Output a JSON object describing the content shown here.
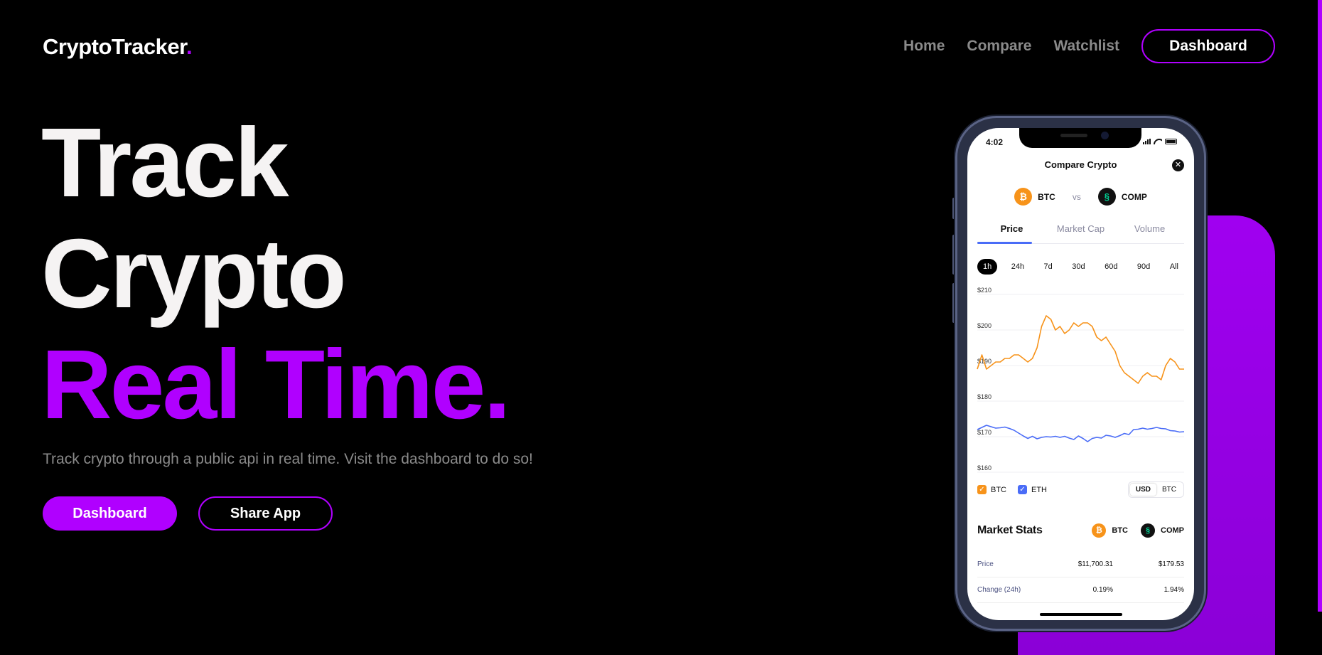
{
  "header": {
    "logo": "CryptoTracker",
    "logo_dot": ".",
    "nav": [
      "Home",
      "Compare",
      "Watchlist"
    ],
    "dashboard_button": "Dashboard"
  },
  "hero": {
    "line1": "Track",
    "line2": "Crypto",
    "line3": "Real Time.",
    "subtitle": "Track crypto through a public api in real time. Visit the dashboard to do so!",
    "primary_button": "Dashboard",
    "secondary_button": "Share App"
  },
  "colors": {
    "accent": "#b000ff",
    "btc_line": "#f7931a",
    "comp_line": "#4a6cf7"
  },
  "phone": {
    "status_time": "4:02",
    "title": "Compare Crypto",
    "close_icon": "close-icon",
    "coin_a": "BTC",
    "coin_b": "COMP",
    "vs": "vs",
    "tabs": [
      "Price",
      "Market Cap",
      "Volume"
    ],
    "active_tab": "Price",
    "ranges": [
      "1h",
      "24h",
      "7d",
      "30d",
      "60d",
      "90d",
      "All"
    ],
    "active_range": "1h",
    "legend": [
      "BTC",
      "ETH"
    ],
    "currency_toggle": [
      "USD",
      "BTC"
    ],
    "active_currency": "USD",
    "market_stats_title": "Market Stats",
    "stats": [
      {
        "label": "Price",
        "a": "$11,700.31",
        "b": "$179.53"
      },
      {
        "label": "Change (24h)",
        "a": "0.19%",
        "b": "1.94%"
      }
    ]
  },
  "chart_data": {
    "type": "line",
    "ylim": [
      160,
      210
    ],
    "y_ticks": [
      "$210",
      "$200",
      "$190",
      "$180",
      "$170",
      "$160"
    ],
    "series": [
      {
        "name": "BTC",
        "values": [
          189,
          193,
          189,
          190,
          191,
          191,
          192,
          192,
          193,
          193,
          192,
          191,
          192,
          195,
          201,
          204,
          203,
          200,
          201,
          199,
          200,
          202,
          201,
          202,
          202,
          201,
          198,
          197,
          198,
          196,
          194,
          190,
          188,
          187,
          186,
          185,
          187,
          188,
          187,
          187,
          186,
          190,
          192,
          191,
          189,
          189
        ]
      },
      {
        "name": "ETH",
        "values": [
          172,
          172.6,
          173.2,
          172.8,
          172.4,
          172.5,
          172.7,
          172.3,
          171.8,
          171,
          170.2,
          169.5,
          170.1,
          169.4,
          169.8,
          170,
          169.9,
          170.1,
          169.8,
          170.1,
          169.6,
          169.2,
          170.2,
          169.5,
          168.6,
          169.5,
          169.8,
          169.6,
          170.4,
          170.2,
          169.8,
          170.3,
          170.9,
          170.6,
          172,
          172.1,
          172.4,
          172.1,
          172.3,
          172.6,
          172.3,
          172.2,
          171.7,
          171.6,
          171.3,
          171.4
        ]
      }
    ]
  }
}
